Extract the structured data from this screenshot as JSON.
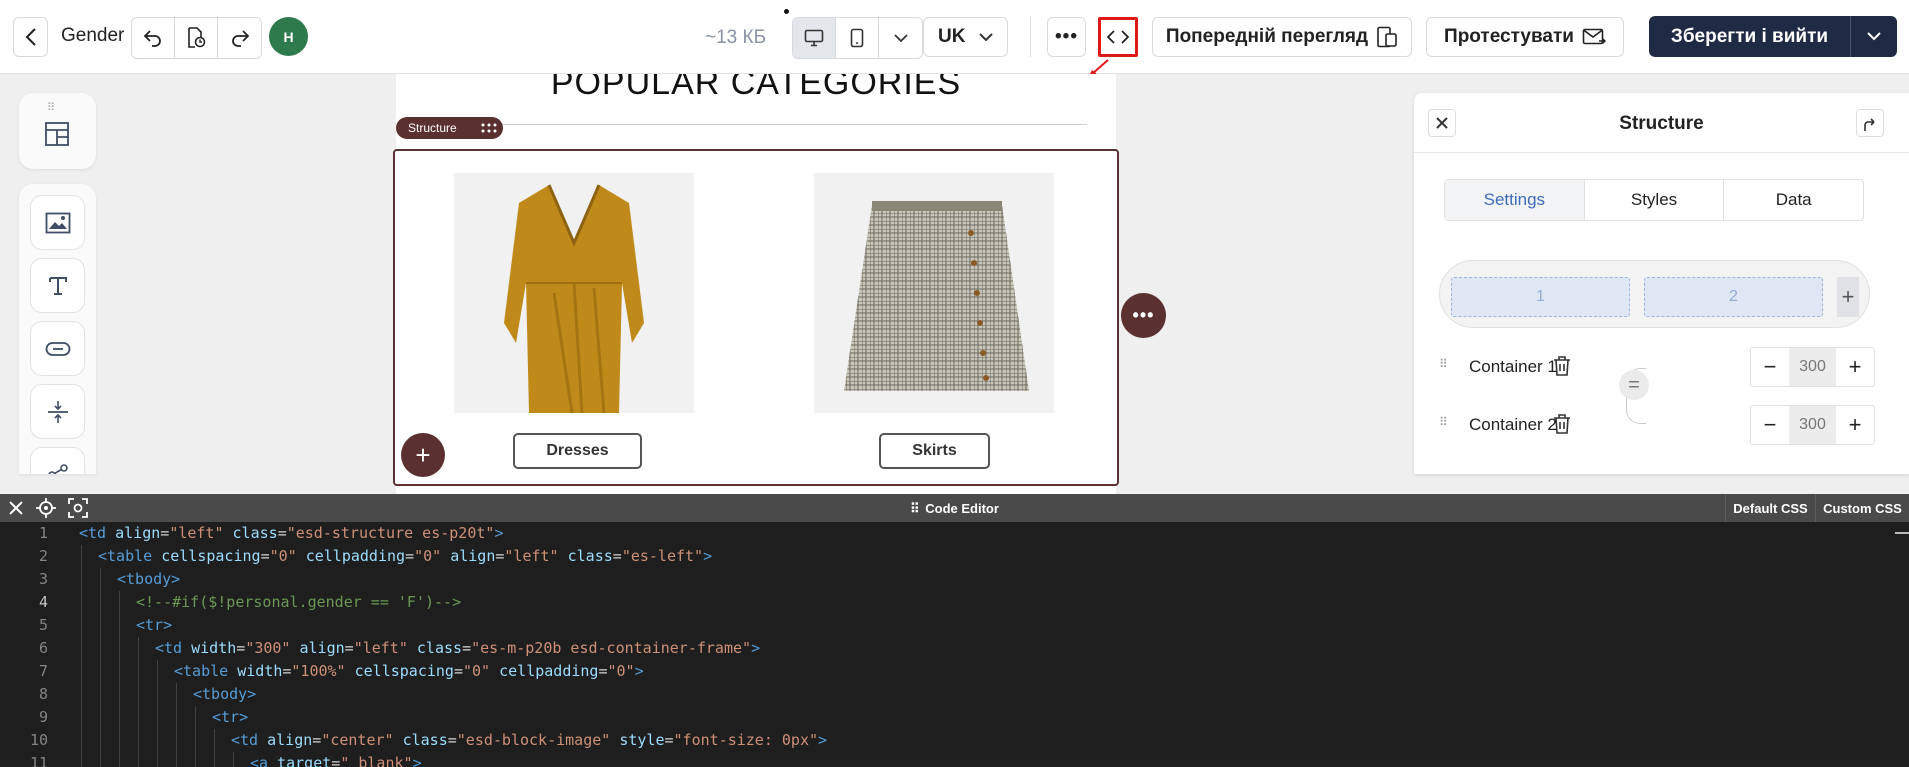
{
  "topbar": {
    "title": "Gender",
    "avatar_initial": "H",
    "size_label": "~13 КБ",
    "lang": "UK",
    "more_label": "•••",
    "preview_label": "Попередній перегляд",
    "test_label": "Протестувати",
    "save_label": "Зберегти і вийти",
    "icons": [
      "back-icon",
      "undo-icon",
      "history-icon",
      "redo-icon",
      "desktop-icon",
      "mobile-icon",
      "chevron-down-icon",
      "code-icon",
      "preview-device-icon",
      "send-mail-icon"
    ],
    "accent_color": "#1f2a44",
    "avatar_color": "#2f7a4d",
    "highlight_color": "#e01818"
  },
  "canvas": {
    "heading": "POPULAR CATEGORIES",
    "structure_pill": "Structure",
    "structure_color": "#5a3130",
    "products": [
      {
        "label": "Dresses"
      },
      {
        "label": "Skirts"
      }
    ],
    "add_symbol": "+",
    "more_symbol": "•••"
  },
  "panel": {
    "title": "Structure",
    "tabs": [
      {
        "label": "Settings",
        "active": true
      },
      {
        "label": "Styles",
        "active": false
      },
      {
        "label": "Data",
        "active": false
      }
    ],
    "columns": [
      "1",
      "2"
    ],
    "column_add": "+",
    "containers": [
      {
        "label": "Container 1",
        "width": "300"
      },
      {
        "label": "Container 2",
        "width": "300"
      }
    ],
    "minus": "−",
    "plus": "+"
  },
  "editor": {
    "title": "Code Editor",
    "tabs": [
      "Default CSS",
      "Custom CSS"
    ],
    "current_line": 4,
    "lines": [
      {
        "n": "1",
        "indent": 0,
        "tokens": [
          [
            "t",
            "<td "
          ],
          [
            "a",
            "align"
          ],
          [
            "x",
            "="
          ],
          [
            "v",
            "\"left\""
          ],
          [
            "x",
            " "
          ],
          [
            "a",
            "class"
          ],
          [
            "x",
            "="
          ],
          [
            "v",
            "\"esd-structure es-p20t\""
          ],
          [
            "t",
            ">"
          ]
        ]
      },
      {
        "n": "2",
        "indent": 1,
        "tokens": [
          [
            "t",
            "<table "
          ],
          [
            "a",
            "cellspacing"
          ],
          [
            "x",
            "="
          ],
          [
            "v",
            "\"0\""
          ],
          [
            "x",
            " "
          ],
          [
            "a",
            "cellpadding"
          ],
          [
            "x",
            "="
          ],
          [
            "v",
            "\"0\""
          ],
          [
            "x",
            " "
          ],
          [
            "a",
            "align"
          ],
          [
            "x",
            "="
          ],
          [
            "v",
            "\"left\""
          ],
          [
            "x",
            " "
          ],
          [
            "a",
            "class"
          ],
          [
            "x",
            "="
          ],
          [
            "v",
            "\"es-left\""
          ],
          [
            "t",
            ">"
          ]
        ]
      },
      {
        "n": "3",
        "indent": 2,
        "tokens": [
          [
            "t",
            "<tbody>"
          ]
        ]
      },
      {
        "n": "4",
        "indent": 3,
        "tokens": [
          [
            "c",
            "<!--#if($!personal.gender == 'F')-->"
          ]
        ]
      },
      {
        "n": "5",
        "indent": 3,
        "tokens": [
          [
            "t",
            "<tr>"
          ]
        ]
      },
      {
        "n": "6",
        "indent": 4,
        "tokens": [
          [
            "t",
            "<td "
          ],
          [
            "a",
            "width"
          ],
          [
            "x",
            "="
          ],
          [
            "v",
            "\"300\""
          ],
          [
            "x",
            " "
          ],
          [
            "a",
            "align"
          ],
          [
            "x",
            "="
          ],
          [
            "v",
            "\"left\""
          ],
          [
            "x",
            " "
          ],
          [
            "a",
            "class"
          ],
          [
            "x",
            "="
          ],
          [
            "v",
            "\"es-m-p20b esd-container-frame\""
          ],
          [
            "t",
            ">"
          ]
        ]
      },
      {
        "n": "7",
        "indent": 5,
        "tokens": [
          [
            "t",
            "<table "
          ],
          [
            "a",
            "width"
          ],
          [
            "x",
            "="
          ],
          [
            "v",
            "\"100%\""
          ],
          [
            "x",
            " "
          ],
          [
            "a",
            "cellspacing"
          ],
          [
            "x",
            "="
          ],
          [
            "v",
            "\"0\""
          ],
          [
            "x",
            " "
          ],
          [
            "a",
            "cellpadding"
          ],
          [
            "x",
            "="
          ],
          [
            "v",
            "\"0\""
          ],
          [
            "t",
            ">"
          ]
        ]
      },
      {
        "n": "8",
        "indent": 6,
        "tokens": [
          [
            "t",
            "<tbody>"
          ]
        ]
      },
      {
        "n": "9",
        "indent": 7,
        "tokens": [
          [
            "t",
            "<tr>"
          ]
        ]
      },
      {
        "n": "10",
        "indent": 8,
        "tokens": [
          [
            "t",
            "<td "
          ],
          [
            "a",
            "align"
          ],
          [
            "x",
            "="
          ],
          [
            "v",
            "\"center\""
          ],
          [
            "x",
            " "
          ],
          [
            "a",
            "class"
          ],
          [
            "x",
            "="
          ],
          [
            "v",
            "\"esd-block-image\""
          ],
          [
            "x",
            " "
          ],
          [
            "a",
            "style"
          ],
          [
            "x",
            "="
          ],
          [
            "v",
            "\"font-size: 0px\""
          ],
          [
            "t",
            ">"
          ]
        ]
      },
      {
        "n": "11",
        "indent": 9,
        "tokens": [
          [
            "t",
            "<a "
          ],
          [
            "a",
            "target"
          ],
          [
            "x",
            "="
          ],
          [
            "v",
            "\"_blank\""
          ],
          [
            "t",
            ">"
          ]
        ]
      }
    ]
  }
}
